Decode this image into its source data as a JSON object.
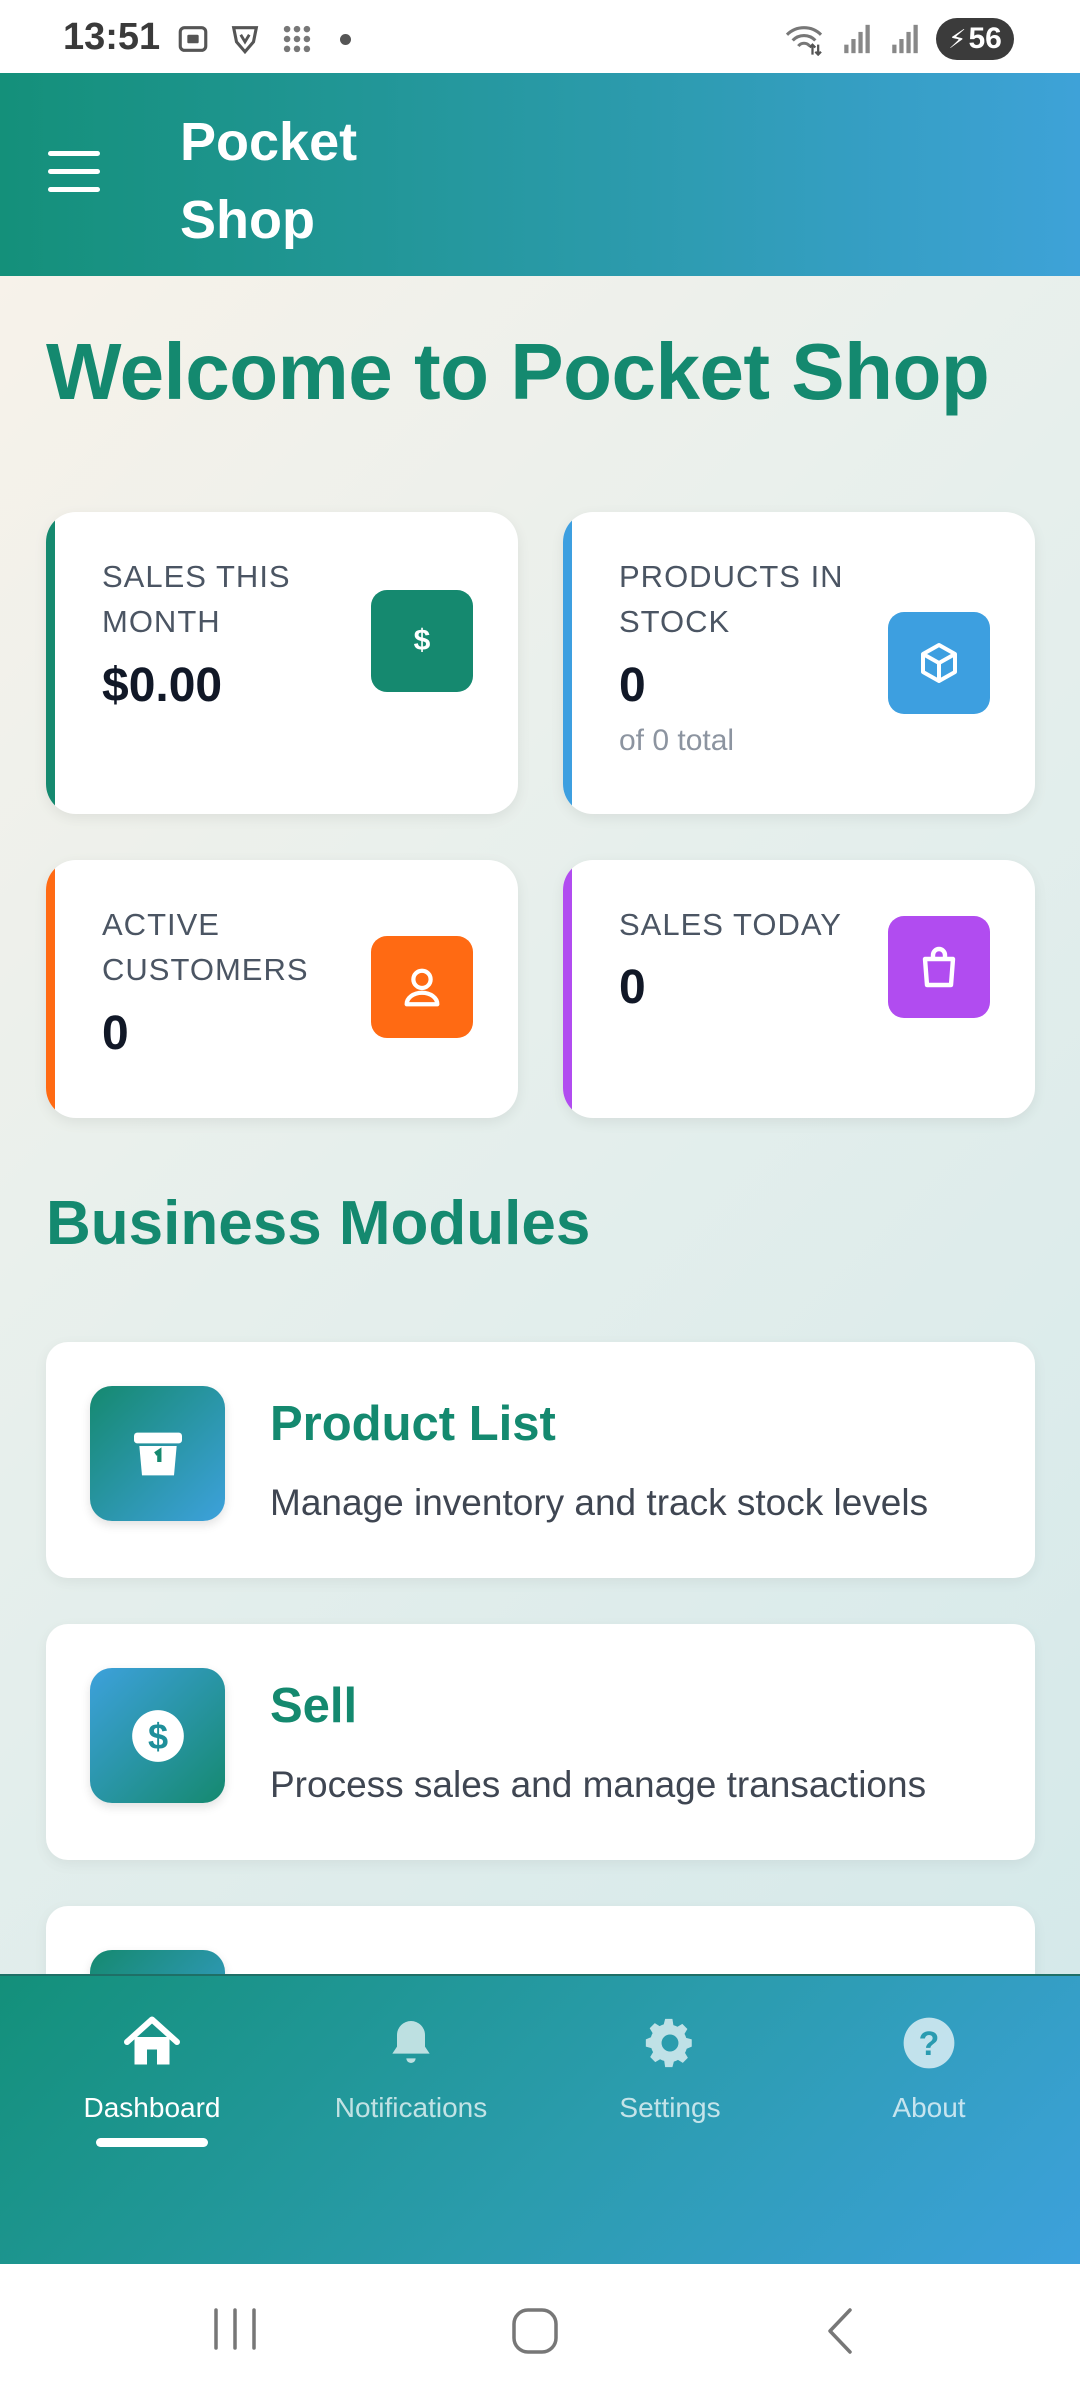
{
  "status_bar": {
    "time": "13:51",
    "battery": "56",
    "icons": [
      "screenshot-icon",
      "vpn-shield-icon",
      "apps-grid-icon",
      "wifi-icon",
      "signal-icon",
      "signal-icon",
      "battery-icon"
    ]
  },
  "header": {
    "title": "Pocket Shop"
  },
  "main": {
    "welcome": "Welcome to Pocket Shop",
    "stats": [
      {
        "label": "SALES THIS MONTH",
        "value": "$0.00",
        "sub": "",
        "color": "#15896f",
        "icon": "dollar-icon"
      },
      {
        "label": "PRODUCTS IN STOCK",
        "value": "0",
        "sub": "of 0 total",
        "color": "#3d9fe0",
        "icon": "box-icon"
      },
      {
        "label": "ACTIVE CUSTOMERS",
        "value": "0",
        "sub": "",
        "color": "#ff6a13",
        "icon": "user-icon"
      },
      {
        "label": "SALES TODAY",
        "value": "0",
        "sub": "",
        "color": "#b14cf0",
        "icon": "shopping-bag-icon"
      }
    ],
    "section_title": "Business Modules",
    "modules": [
      {
        "title": "Product List",
        "desc": "Manage inventory and track stock levels",
        "icon": "archive-box-icon"
      },
      {
        "title": "Sell",
        "desc": "Process sales and manage transactions",
        "icon": "dollar-coin-icon"
      }
    ]
  },
  "bottom_nav": {
    "items": [
      {
        "label": "Dashboard",
        "icon": "home-icon",
        "active": true
      },
      {
        "label": "Notifications",
        "icon": "bell-icon",
        "active": false
      },
      {
        "label": "Settings",
        "icon": "gear-icon",
        "active": false
      },
      {
        "label": "About",
        "icon": "help-circle-icon",
        "active": false
      }
    ]
  },
  "theme": {
    "primary": "#14896f",
    "accent": "#3ea2d8"
  }
}
